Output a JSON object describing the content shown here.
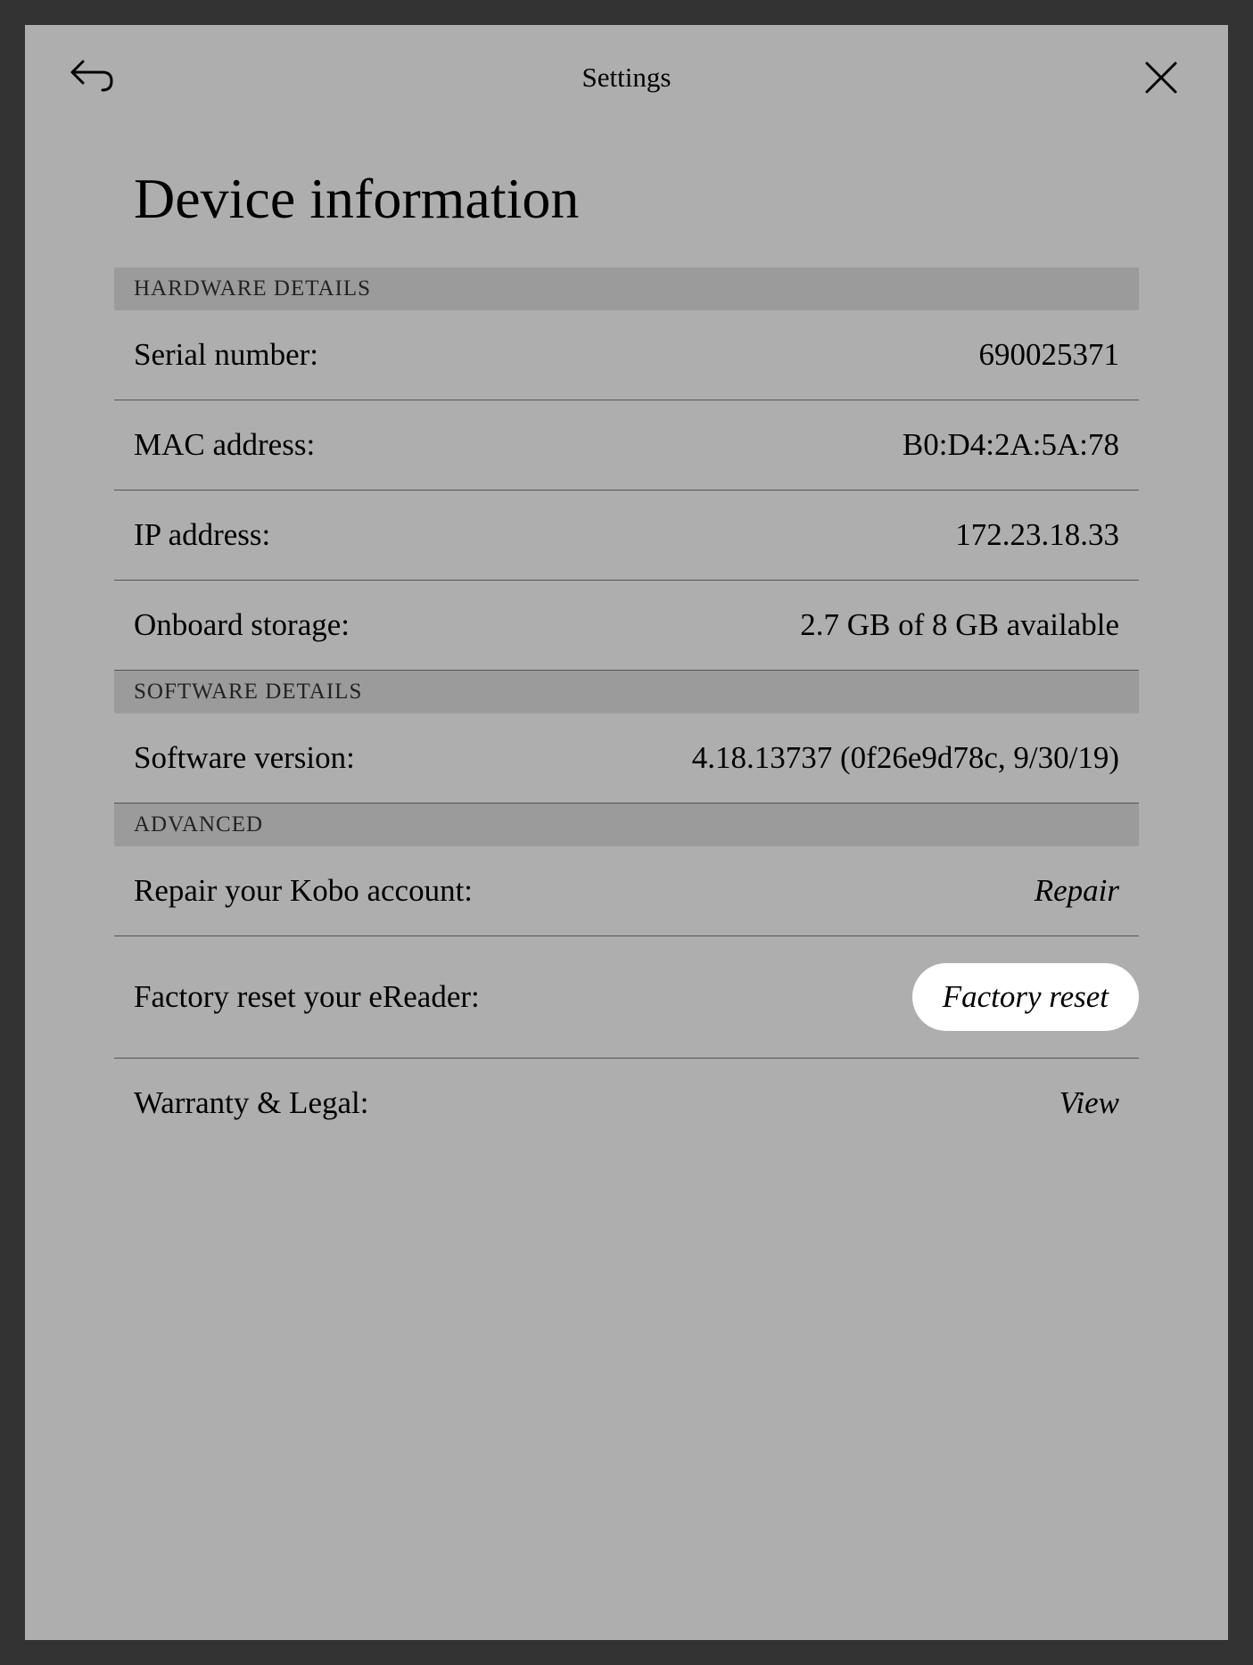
{
  "header": {
    "title": "Settings"
  },
  "page": {
    "title": "Device information"
  },
  "sections": {
    "hardware": {
      "header": "HARDWARE DETAILS",
      "serial_label": "Serial number:",
      "serial_value": "690025371",
      "mac_label": "MAC address:",
      "mac_value": "B0:D4:2A:5A:78",
      "ip_label": "IP address:",
      "ip_value": "172.23.18.33",
      "storage_label": "Onboard storage:",
      "storage_value": "2.7 GB of 8 GB available"
    },
    "software": {
      "header": "SOFTWARE DETAILS",
      "version_label": "Software version:",
      "version_value": "4.18.13737 (0f26e9d78c, 9/30/19)"
    },
    "advanced": {
      "header": "ADVANCED",
      "repair_label": "Repair your Kobo account:",
      "repair_action": "Repair",
      "reset_label": "Factory reset your eReader:",
      "reset_action": "Factory reset",
      "warranty_label": "Warranty & Legal:",
      "warranty_action": "View"
    }
  }
}
